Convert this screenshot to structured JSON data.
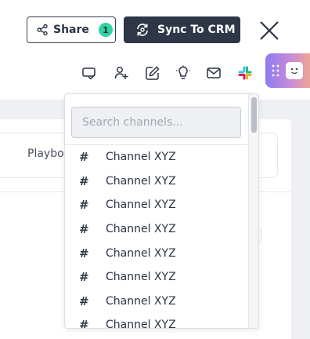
{
  "header": {
    "share_label": "Share",
    "share_count": "1",
    "sync_label": "Sync To CRM"
  },
  "toolbar": {
    "icons": [
      "message-check-icon",
      "add-user-icon",
      "edit-icon",
      "lightbulb-icon",
      "mail-icon",
      "slack-icon"
    ]
  },
  "background": {
    "tab_label": "Playbo"
  },
  "channel_dropdown": {
    "search_placeholder": "Search channels...",
    "hash": "#",
    "channels": [
      "Channel XYZ",
      "Channel XYZ",
      "Channel XYZ",
      "Channel XYZ",
      "Channel XYZ",
      "Channel XYZ",
      "Channel XYZ",
      "Channel XYZ"
    ]
  },
  "colors": {
    "badge": "#2fd4a0",
    "sync_bg": "#2f3647",
    "widget_gradient": [
      "#8d7cf0",
      "#f2a88a"
    ]
  }
}
